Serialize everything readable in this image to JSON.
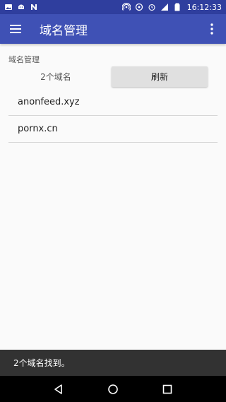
{
  "status_bar": {
    "time": "16:12:33",
    "left_icons": [
      "image-icon",
      "android-icon",
      "n-icon"
    ],
    "right_icons": [
      "hotspot-icon",
      "sync-icon",
      "alarm-icon",
      "signal-icon",
      "battery-icon"
    ]
  },
  "app_bar": {
    "title": "域名管理",
    "accent_color": "#3f51b5",
    "status_color": "#2f3e9e"
  },
  "main": {
    "section_label": "域名管理",
    "count_text": "2个域名",
    "refresh_label": "刷新",
    "domains": [
      "anonfeed.xyz",
      "pornx.cn"
    ]
  },
  "snackbar": {
    "message": "2个域名找到。"
  },
  "nav_bar": {
    "buttons": [
      "back-icon",
      "home-icon",
      "recents-icon"
    ]
  }
}
